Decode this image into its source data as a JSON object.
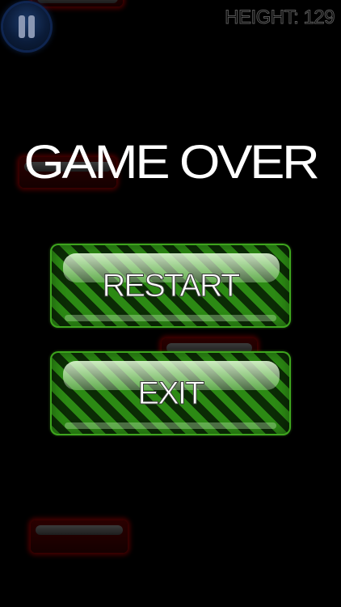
{
  "hud": {
    "height_label": "HEIGHT: 129",
    "pause_icon": "pause-icon"
  },
  "title": "GAME OVER",
  "menu": {
    "restart_label": "RESTART",
    "exit_label": "EXIT"
  },
  "colors": {
    "background": "#000000",
    "button_stripe_light": "#2c8a14",
    "button_stripe_dark": "#0b2b05",
    "platform_glow": "#820000",
    "pause_button": "#0b1c3a"
  }
}
